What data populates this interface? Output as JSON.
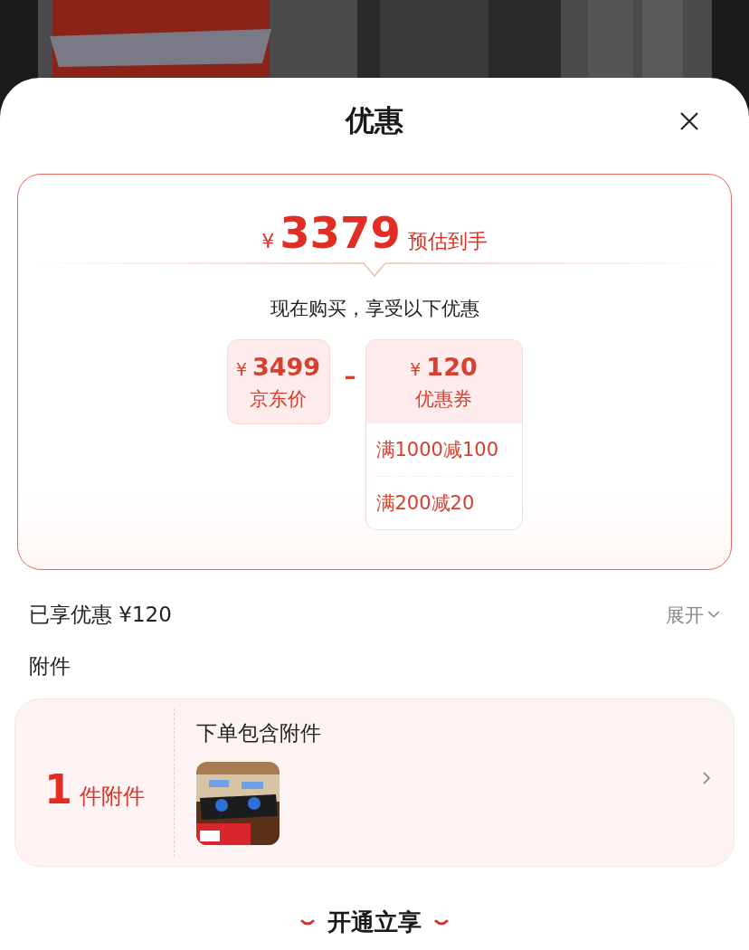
{
  "sheet": {
    "title": "优惠"
  },
  "estimate": {
    "currency": "¥",
    "amount": "3379",
    "label": "预估到手"
  },
  "subtitle": "现在购买，享受以下优惠",
  "price": {
    "currency": "¥",
    "amount": "3499",
    "label": "京东价"
  },
  "operator": "–",
  "coupon": {
    "currency": "¥",
    "amount": "120",
    "label": "优惠券",
    "rules": [
      "满1000减100",
      "满200减20"
    ]
  },
  "enjoyed": {
    "text": "已享优惠 ¥120",
    "expand": "展开"
  },
  "accessories": {
    "heading": "附件",
    "count": "1",
    "unit": "件附件",
    "title": "下单包含附件"
  },
  "footer": {
    "label": "开通立享"
  }
}
